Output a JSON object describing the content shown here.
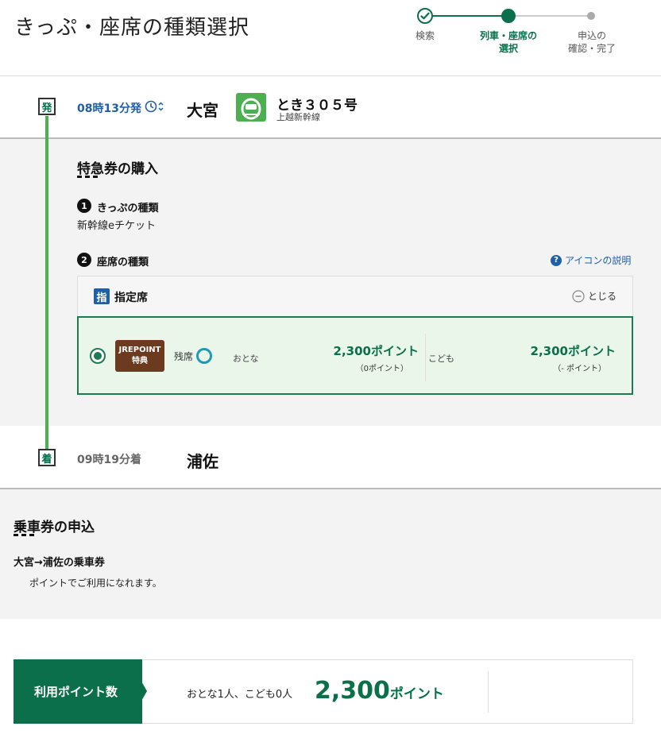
{
  "header": {
    "title": "きっぷ・座席の種類選択",
    "steps": [
      {
        "label_line1": "検索",
        "label_line2": "",
        "state": "done"
      },
      {
        "label_line1": "列車・座席の",
        "label_line2": "選択",
        "state": "current"
      },
      {
        "label_line1": "申込の",
        "label_line2": "確認・完了",
        "state": "todo"
      }
    ]
  },
  "departure": {
    "badge": "発",
    "time": "08時13分発",
    "station": "大宮",
    "train_name": "とき３０５号",
    "line_name": "上越新幹線"
  },
  "express": {
    "title": "特急券の購入",
    "ticket_type": {
      "num": "1",
      "heading": "きっぷの種類",
      "value": "新幹線eチケット"
    },
    "seat_type": {
      "num": "2",
      "heading": "座席の種類"
    },
    "help_link": "アイコンの説明",
    "seat_panel": {
      "icon": "指",
      "label": "指定席",
      "close_label": "とじる"
    },
    "option": {
      "badge_line1": "JREPOINT",
      "badge_line2": "特典",
      "availability_label": "残席",
      "adult_label": "おとな",
      "adult_price": "2,300ポイント",
      "adult_sub": "（0ポイント）",
      "child_label": "こども",
      "child_price": "2,300ポイント",
      "child_sub": "（- ポイント）"
    }
  },
  "arrival": {
    "badge": "着",
    "time": "09時19分着",
    "station": "浦佐"
  },
  "ride": {
    "title": "乗車券の申込",
    "route": "大宮→浦佐の乗車券",
    "note": "ポイントでご利用になれます。"
  },
  "points": {
    "tab_label": "利用ポイント数",
    "passengers": "おとな1人、こども0人",
    "total": "2,300",
    "unit": "ポイント"
  },
  "colors": {
    "brand_green": "#0a6f4a",
    "route_green": "#4caf50",
    "link_blue": "#1f5fa8",
    "jre_brown": "#6b3a1f"
  }
}
